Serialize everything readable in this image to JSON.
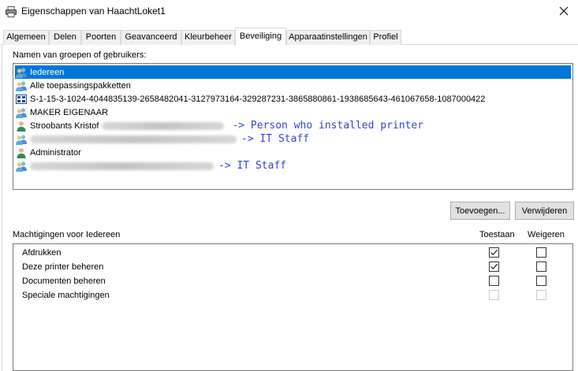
{
  "window": {
    "title": "Eigenschappen van HaachtLoket1",
    "icon": "printer-icon",
    "close_icon": "close-icon"
  },
  "tabs": [
    {
      "label": "Algemeen",
      "active": false
    },
    {
      "label": "Delen",
      "active": false
    },
    {
      "label": "Poorten",
      "active": false
    },
    {
      "label": "Geavanceerd",
      "active": false
    },
    {
      "label": "Kleurbeheer",
      "active": false
    },
    {
      "label": "Beveiliging",
      "active": true
    },
    {
      "label": "Apparaatinstellingen",
      "active": false
    },
    {
      "label": "Profiel",
      "active": false
    }
  ],
  "security": {
    "groups_label": "Namen van groepen of gebruikers:",
    "users": [
      {
        "name": "Iedereen",
        "icon": "group-icon",
        "selected": true
      },
      {
        "name": "Alle toepassingspakketten",
        "icon": "app-packages-icon",
        "selected": false
      },
      {
        "name": "S-1-15-3-1024-4044835139-2658482041-3127973164-329287231-3865880861-1938685643-461067658-1087000422",
        "icon": "sid-icon",
        "selected": false
      },
      {
        "name": "MAKER EIGENAAR",
        "icon": "group-icon",
        "selected": false
      },
      {
        "name": "Stroobants Kristof",
        "icon": "user-icon",
        "selected": false,
        "annotation": "-> Person who installed printer"
      },
      {
        "name": "",
        "icon": "group-icon",
        "selected": false,
        "annotation": "-> IT Staff"
      },
      {
        "name": "Administrator",
        "icon": "user-icon",
        "selected": false
      },
      {
        "name": "",
        "icon": "group-icon",
        "selected": false,
        "annotation": "-> IT Staff"
      }
    ],
    "add_button": "Toevoegen...",
    "remove_button": "Verwijderen",
    "permissions_label": "Machtigingen voor Iedereen",
    "allow_header": "Toestaan",
    "deny_header": "Weigeren",
    "permissions": [
      {
        "name": "Afdrukken",
        "allow": true,
        "deny": false,
        "enabled": true
      },
      {
        "name": "Deze printer beheren",
        "allow": true,
        "deny": false,
        "enabled": true
      },
      {
        "name": "Documenten beheren",
        "allow": false,
        "deny": false,
        "enabled": true
      },
      {
        "name": "Speciale machtigingen",
        "allow": false,
        "deny": false,
        "enabled": false
      }
    ]
  },
  "colors": {
    "selection": "#0078d7",
    "annotation": "#3344d6",
    "button_bg": "#e1e1e1"
  }
}
